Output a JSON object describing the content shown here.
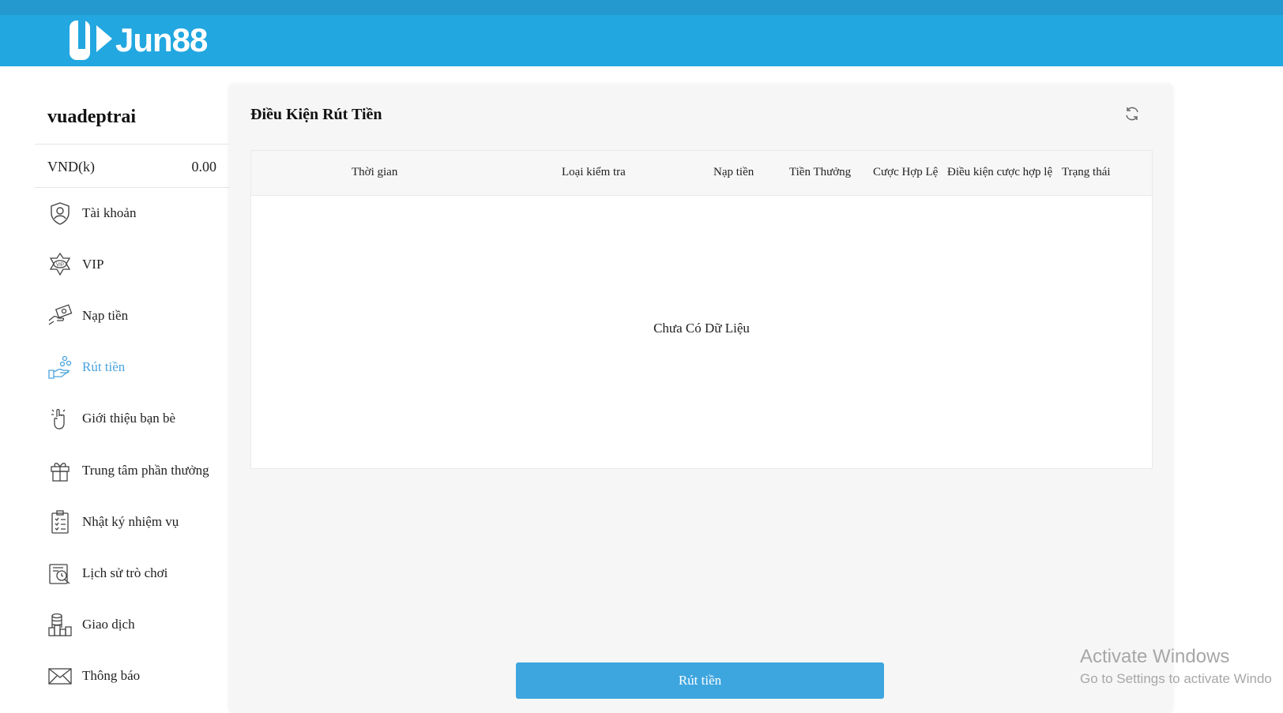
{
  "header": {
    "logo_text": "Jun88",
    "brand_color": "#22a7e0"
  },
  "sidebar": {
    "username": "vuadeptrai",
    "balance_label": "VND(k)",
    "balance_value": "0.00",
    "items": [
      {
        "label": "Tài khoản",
        "icon": "shield-user-icon"
      },
      {
        "label": "VIP",
        "icon": "vip-badge-icon"
      },
      {
        "label": "Nạp tiền",
        "icon": "deposit-hand-icon"
      },
      {
        "label": "Rút tiền",
        "icon": "withdraw-coins-icon",
        "active": true
      },
      {
        "label": "Giới thiệu bạn bè",
        "icon": "referral-hand-icon"
      },
      {
        "label": "Trung tâm phần thưởng",
        "icon": "gift-icon"
      },
      {
        "label": "Nhật ký nhiệm vụ",
        "icon": "task-list-icon"
      },
      {
        "label": "Lịch sử trò chơi",
        "icon": "game-history-icon"
      },
      {
        "label": "Giao dịch",
        "icon": "transaction-coins-icon"
      },
      {
        "label": "Thông báo",
        "icon": "mail-icon"
      }
    ]
  },
  "main": {
    "title": "Điều Kiện Rút Tiền",
    "columns": [
      "Thời gian",
      "Loại kiểm tra",
      "Nạp tiền",
      "Tiền Thưởng",
      "Cược Hợp Lệ",
      "Điều kiện cược hợp lệ",
      "Trạng thái"
    ],
    "empty_text": "Chưa Có Dữ Liệu",
    "withdraw_button": "Rút tiền",
    "accent_color": "#3ea6df"
  },
  "os_watermark": {
    "title": "Activate Windows",
    "subtitle": "Go to Settings to activate Windo"
  }
}
